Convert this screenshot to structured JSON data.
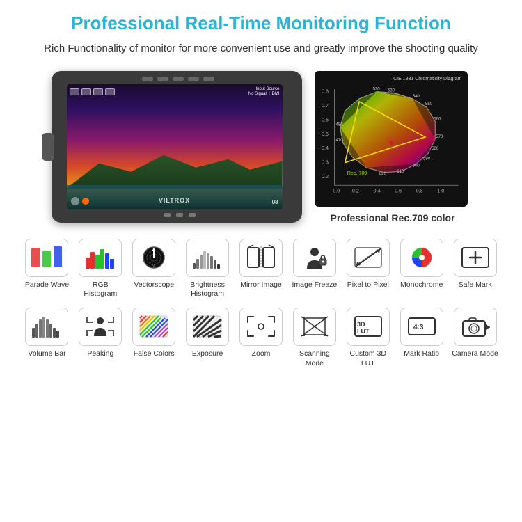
{
  "page": {
    "title": "Professional Real-Time Monitoring Function",
    "subtitle": "Rich Functionality of monitor for more convenient use and greatly improve the shooting quality",
    "color_label": "Professional Rec.709 color",
    "monitor": {
      "brand": "VILTROX",
      "input_source": "Input Source",
      "no_signal": "No Signal: HDMI"
    },
    "features": [
      {
        "id": "parade-wave",
        "label": "Parade Wave"
      },
      {
        "id": "rgb-histogram",
        "label": "RGB Histogram"
      },
      {
        "id": "vectorscope",
        "label": "Vectorscope"
      },
      {
        "id": "brightness-histogram",
        "label": "Brightness Histogram"
      },
      {
        "id": "mirror-image",
        "label": "Mirror Image"
      },
      {
        "id": "image-freeze",
        "label": "Image Freeze"
      },
      {
        "id": "pixel-to-pixel",
        "label": "Pixel to Pixel"
      },
      {
        "id": "monochrome",
        "label": "Monochrome"
      },
      {
        "id": "safe-mark",
        "label": "Safe Mark"
      },
      {
        "id": "volume-bar",
        "label": "Volume Bar"
      },
      {
        "id": "peaking",
        "label": "Peaking"
      },
      {
        "id": "false-colors",
        "label": "False Colors"
      },
      {
        "id": "exposure",
        "label": "Exposure"
      },
      {
        "id": "zoom",
        "label": "Zoom"
      },
      {
        "id": "scanning-mode",
        "label": "Scanning Mode"
      },
      {
        "id": "custom-3d-lut",
        "label": "Custom 3D LUT"
      },
      {
        "id": "mark-ratio",
        "label": "Mark Ratio"
      },
      {
        "id": "camera-mode",
        "label": "Camera Mode"
      }
    ]
  }
}
